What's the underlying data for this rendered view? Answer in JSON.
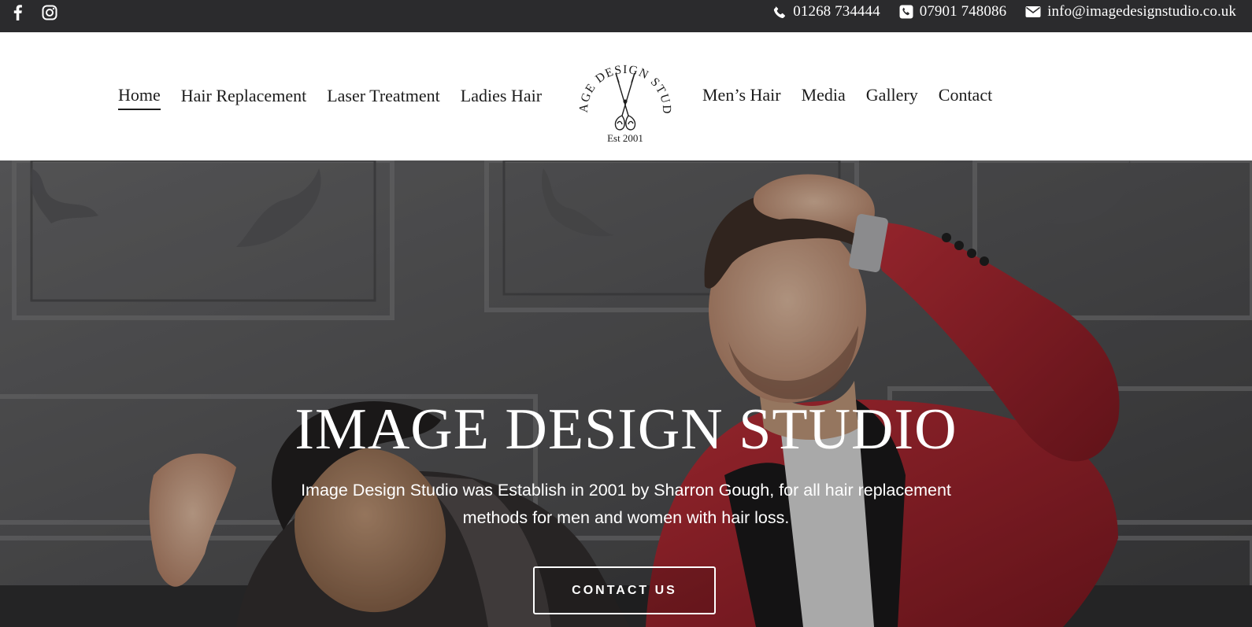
{
  "topbar": {
    "social": [
      {
        "name": "facebook-icon"
      },
      {
        "name": "instagram-icon"
      }
    ],
    "phone": "01268 734444",
    "mobile": "07901 748086",
    "email": "info@imagedesignstudio.co.uk"
  },
  "nav": {
    "left": [
      "Home",
      "Hair Replacement",
      "Laser Treatment",
      "Ladies Hair"
    ],
    "right": [
      "Men’s Hair",
      "Media",
      "Gallery",
      "Contact"
    ],
    "active": "Home"
  },
  "logo": {
    "arc_text": "IMAGE DESIGN STUDIO",
    "est": "Est 2001"
  },
  "hero": {
    "title": "IMAGE DESIGN STUDIO",
    "text": "Image Design Studio was Establish in 2001 by Sharron Gough, for all hair replacement methods for men and women with hair loss.",
    "button": "CONTACT US"
  },
  "colors": {
    "topbar_bg": "#2b2b2d",
    "jacket_red": "#b8252f",
    "text_dark": "#1c1c1c"
  }
}
